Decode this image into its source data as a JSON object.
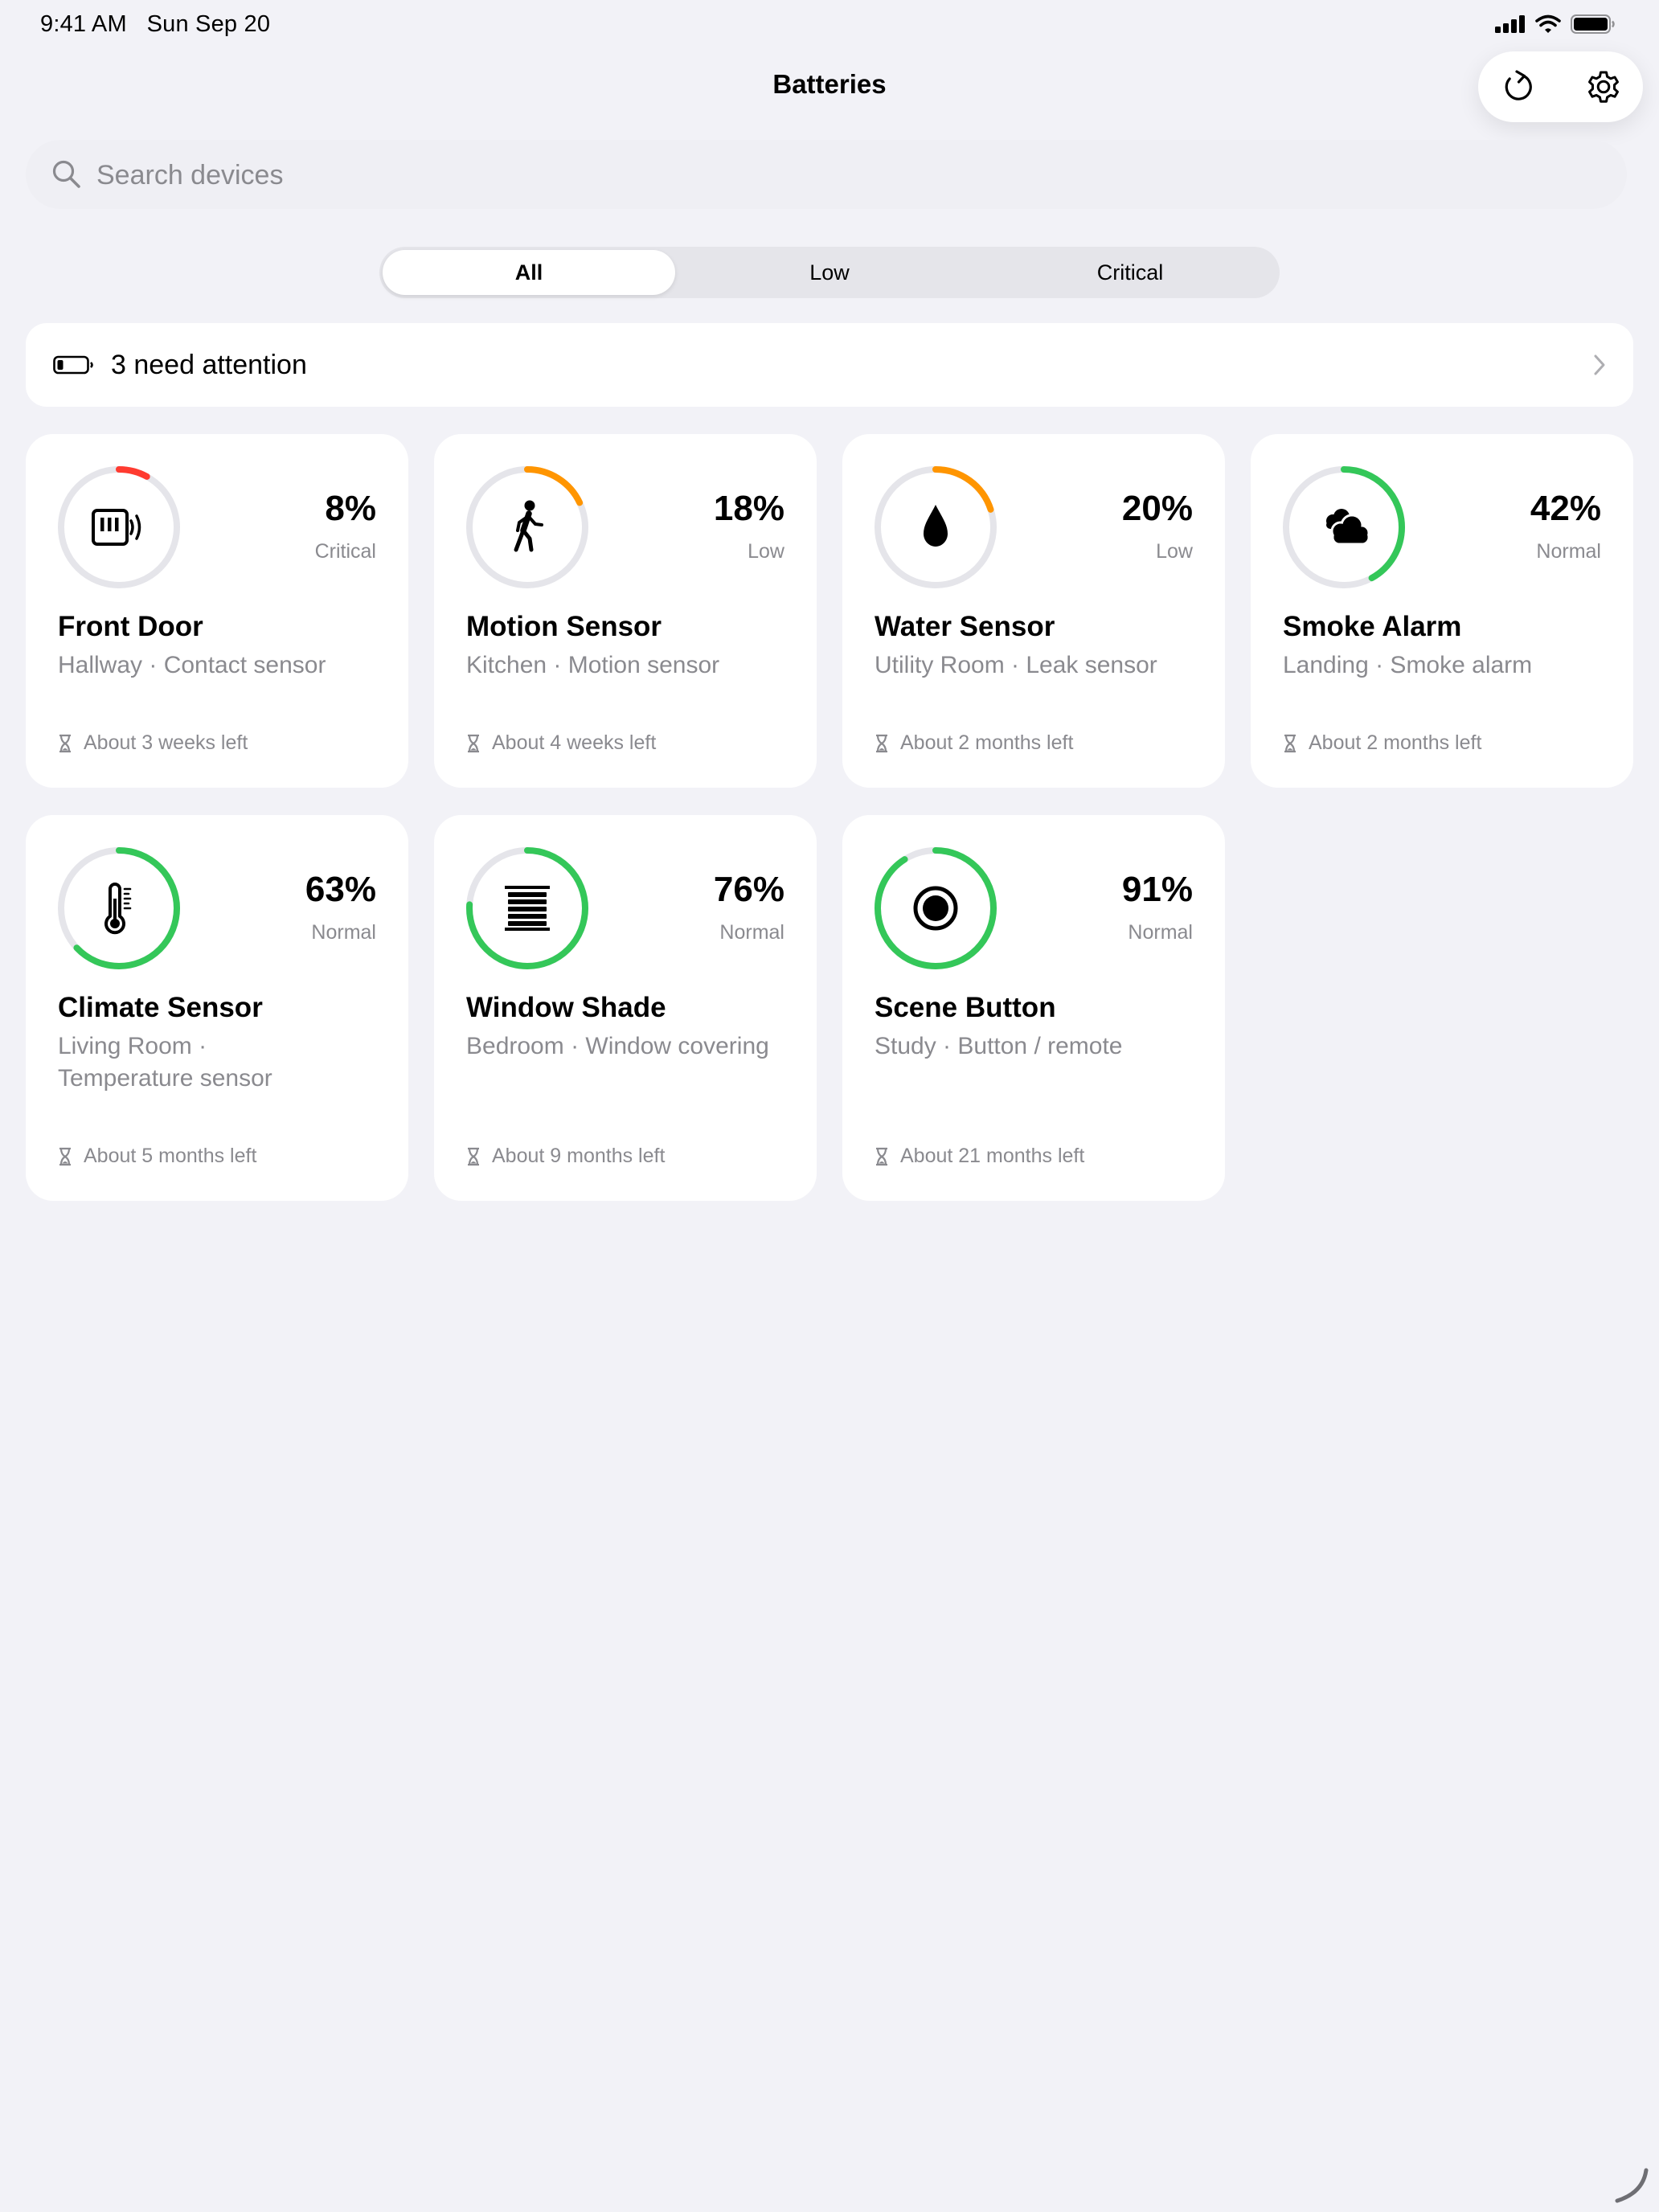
{
  "status_bar": {
    "time": "9:41 AM",
    "date": "Sun Sep 20"
  },
  "header": {
    "title": "Batteries"
  },
  "toolbar": {
    "refresh_icon": "refresh-icon",
    "settings_icon": "gear-icon"
  },
  "search": {
    "placeholder": "Search devices",
    "value": ""
  },
  "filters": [
    {
      "label": "All",
      "selected": true
    },
    {
      "label": "Low",
      "selected": false
    },
    {
      "label": "Critical",
      "selected": false
    }
  ],
  "attention": {
    "label": "3 need attention"
  },
  "colors": {
    "critical": "#ff3b30",
    "low": "#ff9500",
    "normal": "#34c759",
    "track": "#e5e5ea"
  },
  "devices": [
    {
      "name": "Front Door",
      "subtitle": "Hallway · Contact sensor",
      "percent_label": "8%",
      "level": 0.08,
      "status": "Critical",
      "remaining": "About 3 weeks left",
      "icon": "contact-sensor-icon"
    },
    {
      "name": "Motion Sensor",
      "subtitle": "Kitchen · Motion sensor",
      "percent_label": "18%",
      "level": 0.18,
      "status": "Low",
      "remaining": "About 4 weeks left",
      "icon": "walking-person-icon"
    },
    {
      "name": "Water Sensor",
      "subtitle": "Utility Room · Leak sensor",
      "percent_label": "20%",
      "level": 0.2,
      "status": "Low",
      "remaining": "About 2 months left",
      "icon": "water-drop-icon"
    },
    {
      "name": "Smoke Alarm",
      "subtitle": "Landing · Smoke alarm",
      "percent_label": "42%",
      "level": 0.42,
      "status": "Normal",
      "remaining": "About 2 months left",
      "icon": "smoke-cloud-icon"
    },
    {
      "name": "Climate Sensor",
      "subtitle": "Living Room · Temperature sensor",
      "percent_label": "63%",
      "level": 0.63,
      "status": "Normal",
      "remaining": "About 5 months left",
      "icon": "thermometer-icon"
    },
    {
      "name": "Window Shade",
      "subtitle": "Bedroom · Window covering",
      "percent_label": "76%",
      "level": 0.76,
      "status": "Normal",
      "remaining": "About 9 months left",
      "icon": "window-shade-icon"
    },
    {
      "name": "Scene Button",
      "subtitle": "Study · Button / remote",
      "percent_label": "91%",
      "level": 0.91,
      "status": "Normal",
      "remaining": "About 21 months left",
      "icon": "scene-button-icon"
    }
  ]
}
